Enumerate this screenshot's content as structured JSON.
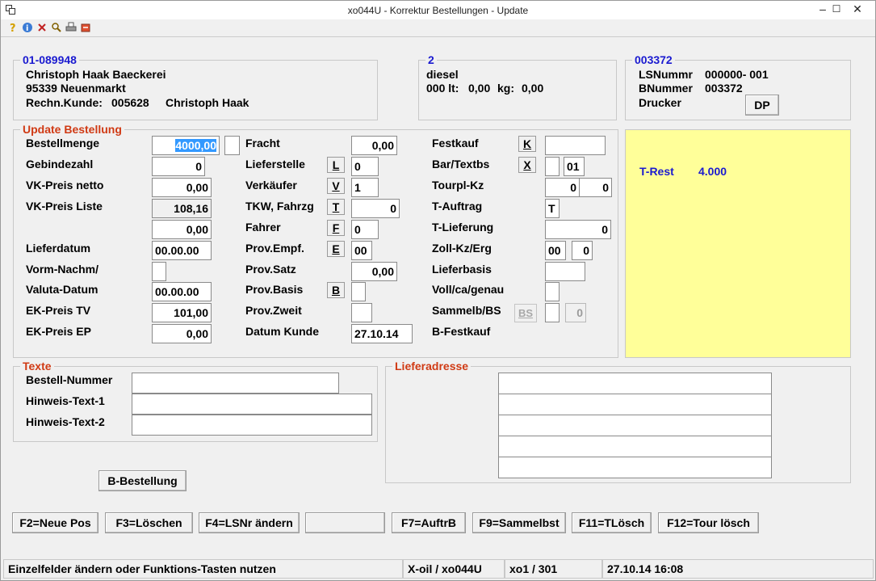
{
  "window": {
    "title": "xo044U - Korrektur Bestellungen - Update",
    "minimize": "–",
    "maximize": "☐",
    "close": "✕"
  },
  "toolbar": {
    "icons": [
      "help-icon",
      "info-icon",
      "close-icon",
      "search-icon",
      "print-icon",
      "refresh-icon"
    ]
  },
  "customer": {
    "number": "01-089948",
    "name": "Christoph Haak Baeckerei",
    "city": "95339 Neuenmarkt",
    "invoice_label": "Rechn.Kunde:",
    "invoice_number": "005628",
    "invoice_name": "Christoph Haak"
  },
  "product": {
    "number": "2",
    "name": "diesel",
    "lt_label": "000 lt:",
    "lt_value": "0,00",
    "kg_label": "kg:",
    "kg_value": "0,00"
  },
  "delivery": {
    "number": "003372",
    "ls_label": "LSNummr",
    "ls_value": "000000- 001",
    "b_label": "BNummer",
    "b_value": "003372",
    "printer_label": "Drucker",
    "dp_button": "DP"
  },
  "update": {
    "legend": "Update Bestellung",
    "col1": {
      "labels": [
        "Bestellmenge",
        "Gebindezahl",
        "VK-Preis netto",
        "VK-Preis Liste",
        "Lieferdatum",
        "Vorm-Nachm/",
        "Valuta-Datum",
        "EK-Preis TV",
        "EK-Preis EP"
      ],
      "bestellmenge": "4000,00",
      "gebindezahl": "0",
      "vk_netto": "0,00",
      "vk_liste": "108,16",
      "extra": "0,00",
      "lieferdatum": "00.00.00",
      "vorm_nachm": "",
      "valuta": "00.00.00",
      "ek_tv": "101,00",
      "ek_ep": "0,00"
    },
    "col2": {
      "labels": [
        "Fracht",
        "Lieferstelle",
        "Verkäufer",
        "TKW, Fahrzg",
        "Fahrer",
        "Prov.Empf.",
        "Prov.Satz",
        "Prov.Basis",
        "Prov.Zweit",
        "Datum Kunde"
      ],
      "buttons": {
        "lieferstelle": "L",
        "verkaeufer": "V",
        "tkw": "T",
        "fahrer": "F",
        "prov_empf": "E",
        "prov_basis": "B"
      },
      "fracht": "0,00",
      "lieferstelle": "0",
      "verkaeufer": "1",
      "tkw": "0",
      "fahrer": "0",
      "prov_empf": "00",
      "prov_satz": "0,00",
      "prov_basis": "",
      "prov_zweit": "",
      "datum_kunde": "27.10.14"
    },
    "col3": {
      "labels": [
        "Festkauf",
        "Bar/Textbs",
        "Tourpl-Kz",
        "T-Auftrag",
        "T-Lieferung",
        "Zoll-Kz/Erg",
        "Lieferbasis",
        "Voll/ca/genau",
        "Sammelb/BS",
        "B-Festkauf"
      ],
      "buttons": {
        "festkauf": "K",
        "bar": "X",
        "sammelb": "BS"
      },
      "festkauf": "",
      "bar1": "",
      "bar2": "01",
      "tourpl1": "0",
      "tourpl2": "0",
      "t_auftrag": "T",
      "t_lieferung": "0",
      "zoll1": "00",
      "zoll2": "0",
      "lieferbasis": "",
      "voll": "",
      "sammelb1": "",
      "sammelb2": "0"
    }
  },
  "rest": {
    "label": "T-Rest",
    "value": "4.000"
  },
  "texte": {
    "legend": "Texte",
    "labels": [
      "Bestell-Nummer",
      "Hinweis-Text-1",
      "Hinweis-Text-2"
    ],
    "values": [
      "",
      "",
      ""
    ]
  },
  "lieferadresse": {
    "legend": "Lieferadresse",
    "lines": [
      "",
      "",
      "",
      "",
      ""
    ]
  },
  "b_bestellung": "B-Bestellung",
  "fkeys": [
    "F2=Neue Pos",
    "F3=Löschen",
    "F4=LSNr ändern",
    "",
    "F7=AuftrB",
    "F9=Sammelbst",
    "F11=TLösch",
    "F12=Tour lösch"
  ],
  "statusbar": {
    "message": "Einzelfelder ändern oder Funktions-Tasten nutzen",
    "program": "X-oil / xo044U",
    "position": "xo1 / 301",
    "datetime": "27.10.14 16:08"
  }
}
